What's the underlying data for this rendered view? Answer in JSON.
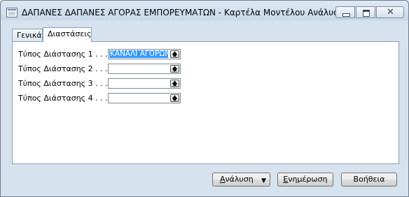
{
  "window": {
    "title": "ΔΑΠΑΝΕΣ ΔΑΠΑΝΕΣ ΑΓΟΡΑΣ ΕΜΠΟΡΕΥΜΑΤΩΝ - Καρτέλα Μοντέλου Ανάλυσης",
    "icons": {
      "app": "app-window-icon",
      "minimize": "minimize-icon",
      "maximize": "maximize-icon",
      "close": "close-icon"
    },
    "close_glyph": "✕"
  },
  "tabs": [
    {
      "label": "Γενικά",
      "active": false
    },
    {
      "label": "Διαστάσεις",
      "active": true
    }
  ],
  "dimensions": {
    "rows": [
      {
        "label": "Τύπος Διάστασης 1 . . .",
        "value": "ΚΑΝΑΛΙ ΑΓΟΡΩΝ",
        "selected": true
      },
      {
        "label": "Τύπος Διάστασης 2 . . .",
        "value": ""
      },
      {
        "label": "Τύπος Διάστασης 3 . . .",
        "value": ""
      },
      {
        "label": "Τύπος Διάστασης 4 . . .",
        "value": ""
      }
    ],
    "lookup_glyph": "🡅",
    "lookup_icon": "lookup-arrow-icon"
  },
  "buttons": {
    "analysis": {
      "label_accel": "Α",
      "label_rest": "νάλυση",
      "arrow": "▼"
    },
    "update": {
      "label_accel": "Ε",
      "label_rest": "νημέρωση"
    },
    "help": {
      "label": "Βοήθεια"
    }
  },
  "colors": {
    "selection": "#3399ff",
    "panel_bg": "#ffffff",
    "window_bg": "#d6e2ee"
  }
}
